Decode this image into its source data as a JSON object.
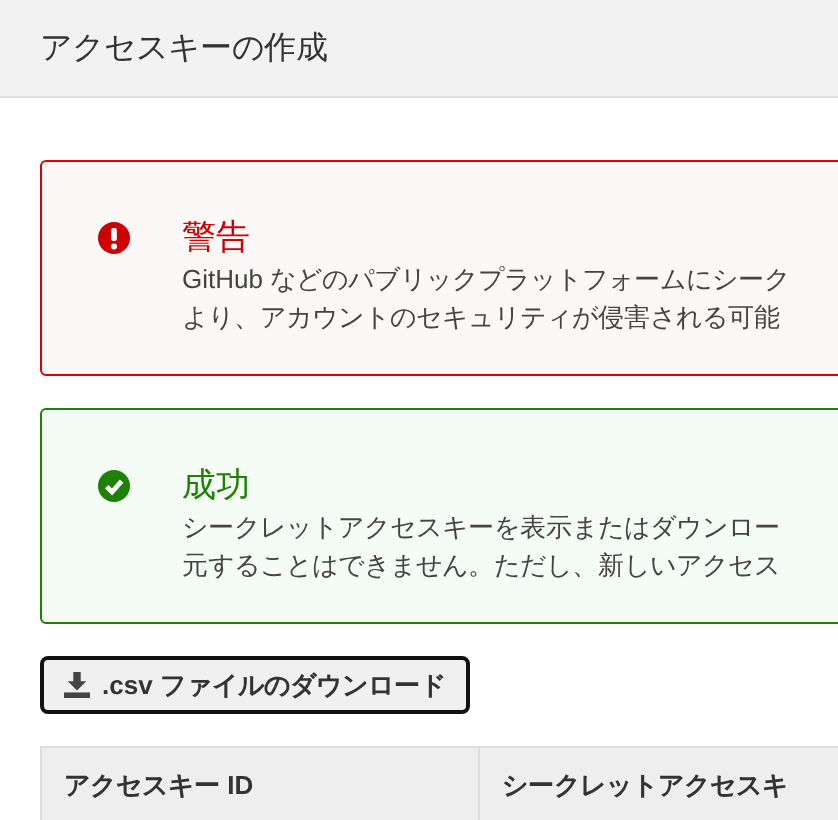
{
  "header": {
    "title": "アクセスキーの作成"
  },
  "alerts": [
    {
      "kind": "warning",
      "title": "警告",
      "lines": [
        "GitHub などのパブリックプラットフォームにシーク",
        "より、アカウントのセキュリティが侵害される可能"
      ]
    },
    {
      "kind": "success",
      "title": "成功",
      "lines": [
        "シークレットアクセスキーを表示またはダウンロー",
        "元することはできません。ただし、新しいアクセス"
      ]
    }
  ],
  "download_button": {
    "label": ".csv ファイルのダウンロード"
  },
  "table": {
    "columns": [
      "アクセスキー ID",
      "シークレットアクセスキ"
    ]
  }
}
